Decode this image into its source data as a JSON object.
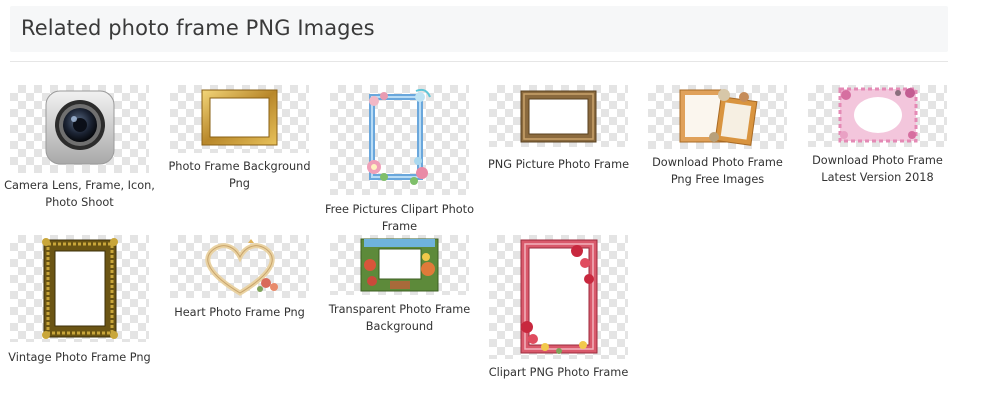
{
  "section": {
    "title": "Related photo frame PNG Images"
  },
  "items": [
    {
      "label": "Camera Lens, Frame, Icon, Photo Shoot",
      "icon": "camera-lens-icon"
    },
    {
      "label": "Photo Frame Background Png",
      "icon": "gold-frame-image"
    },
    {
      "label": "Free Pictures Clipart Photo Frame",
      "icon": "blue-floral-frame-image"
    },
    {
      "label": "PNG Picture Photo Frame",
      "icon": "bronze-frame-image"
    },
    {
      "label": "Download Photo Frame Png Free Images",
      "icon": "orange-collage-frame-image"
    },
    {
      "label": "Download Photo Frame Latest Version 2018",
      "icon": "pink-floral-frame-image"
    },
    {
      "label": "Vintage Photo Frame Png",
      "icon": "vintage-gold-frame-image"
    },
    {
      "label": "Heart Photo Frame Png",
      "icon": "heart-frame-image"
    },
    {
      "label": "Transparent Photo Frame Background",
      "icon": "cartoon-frame-image"
    },
    {
      "label": "Clipart PNG Photo Frame",
      "icon": "rose-frame-image"
    }
  ],
  "colors": {
    "header_bg": "#f6f7f8",
    "checker": "#e4e4e4",
    "text": "#333333"
  }
}
